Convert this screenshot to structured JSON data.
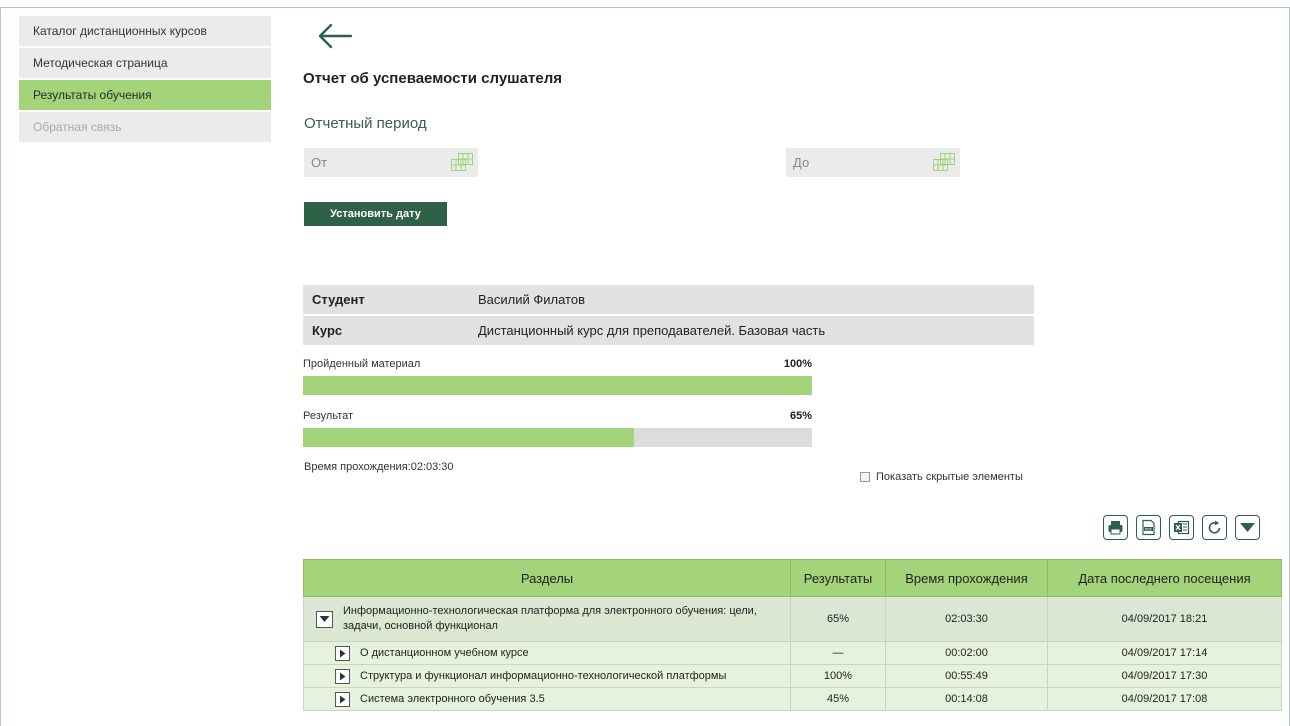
{
  "sidebar": {
    "items": [
      {
        "label": "Каталог дистанционных курсов",
        "state": "normal"
      },
      {
        "label": "Методическая страница",
        "state": "normal"
      },
      {
        "label": "Результаты обучения",
        "state": "active"
      },
      {
        "label": "Обратная связь",
        "state": "disabled"
      }
    ]
  },
  "header": {
    "back_icon": "arrow-left-icon",
    "title": "Отчет об успеваемости слушателя"
  },
  "period": {
    "label": "Отчетный период",
    "from_placeholder": "От",
    "to_placeholder": "До",
    "calendar_icon": "calendar-icon",
    "set_button": "Установить дату"
  },
  "info": {
    "student_label": "Студент",
    "student_value": "Василий Филатов",
    "course_label": "Курс",
    "course_value": "Дистанционный курс для преподавателей. Базовая часть"
  },
  "progress": {
    "material_label": "Пройденный материал",
    "material_pct": "100%",
    "material_value": 100,
    "result_label": "Результат",
    "result_pct": "65%",
    "result_value": 65,
    "time_text": "Время прохождения:02:03:30"
  },
  "options": {
    "show_hidden_label": "Показать скрытые элементы"
  },
  "toolbar": {
    "icons": [
      "print-icon",
      "pdf-icon",
      "excel-icon",
      "refresh-icon",
      "dropdown-icon"
    ]
  },
  "table": {
    "headers": [
      "Разделы",
      "Результаты",
      "Время прохождения",
      "Дата последнего посещения"
    ],
    "rows": [
      {
        "level": 0,
        "expanded": true,
        "section": "Информационно-технологическая платформа для электронного обучения: цели, задачи, основной функционал",
        "result": "65%",
        "time": "02:03:30",
        "date": "04/09/2017 18:21"
      },
      {
        "level": 1,
        "expanded": false,
        "section": "О дистанционном учебном курсе",
        "result": "—",
        "time": "00:02:00",
        "date": "04/09/2017 17:14"
      },
      {
        "level": 1,
        "expanded": false,
        "section": "Структура и функционал информационно-технологической платформы",
        "result": "100%",
        "time": "00:55:49",
        "date": "04/09/2017 17:30"
      },
      {
        "level": 1,
        "expanded": false,
        "section": "Система электронного обучения 3.5",
        "result": "45%",
        "time": "00:14:08",
        "date": "04/09/2017 17:08"
      }
    ]
  },
  "colors": {
    "accent_green": "#a3d47a",
    "dark_green": "#2f6148",
    "row_bg_main": "#dbe7d3",
    "row_bg_sub": "#e6f2dd"
  }
}
